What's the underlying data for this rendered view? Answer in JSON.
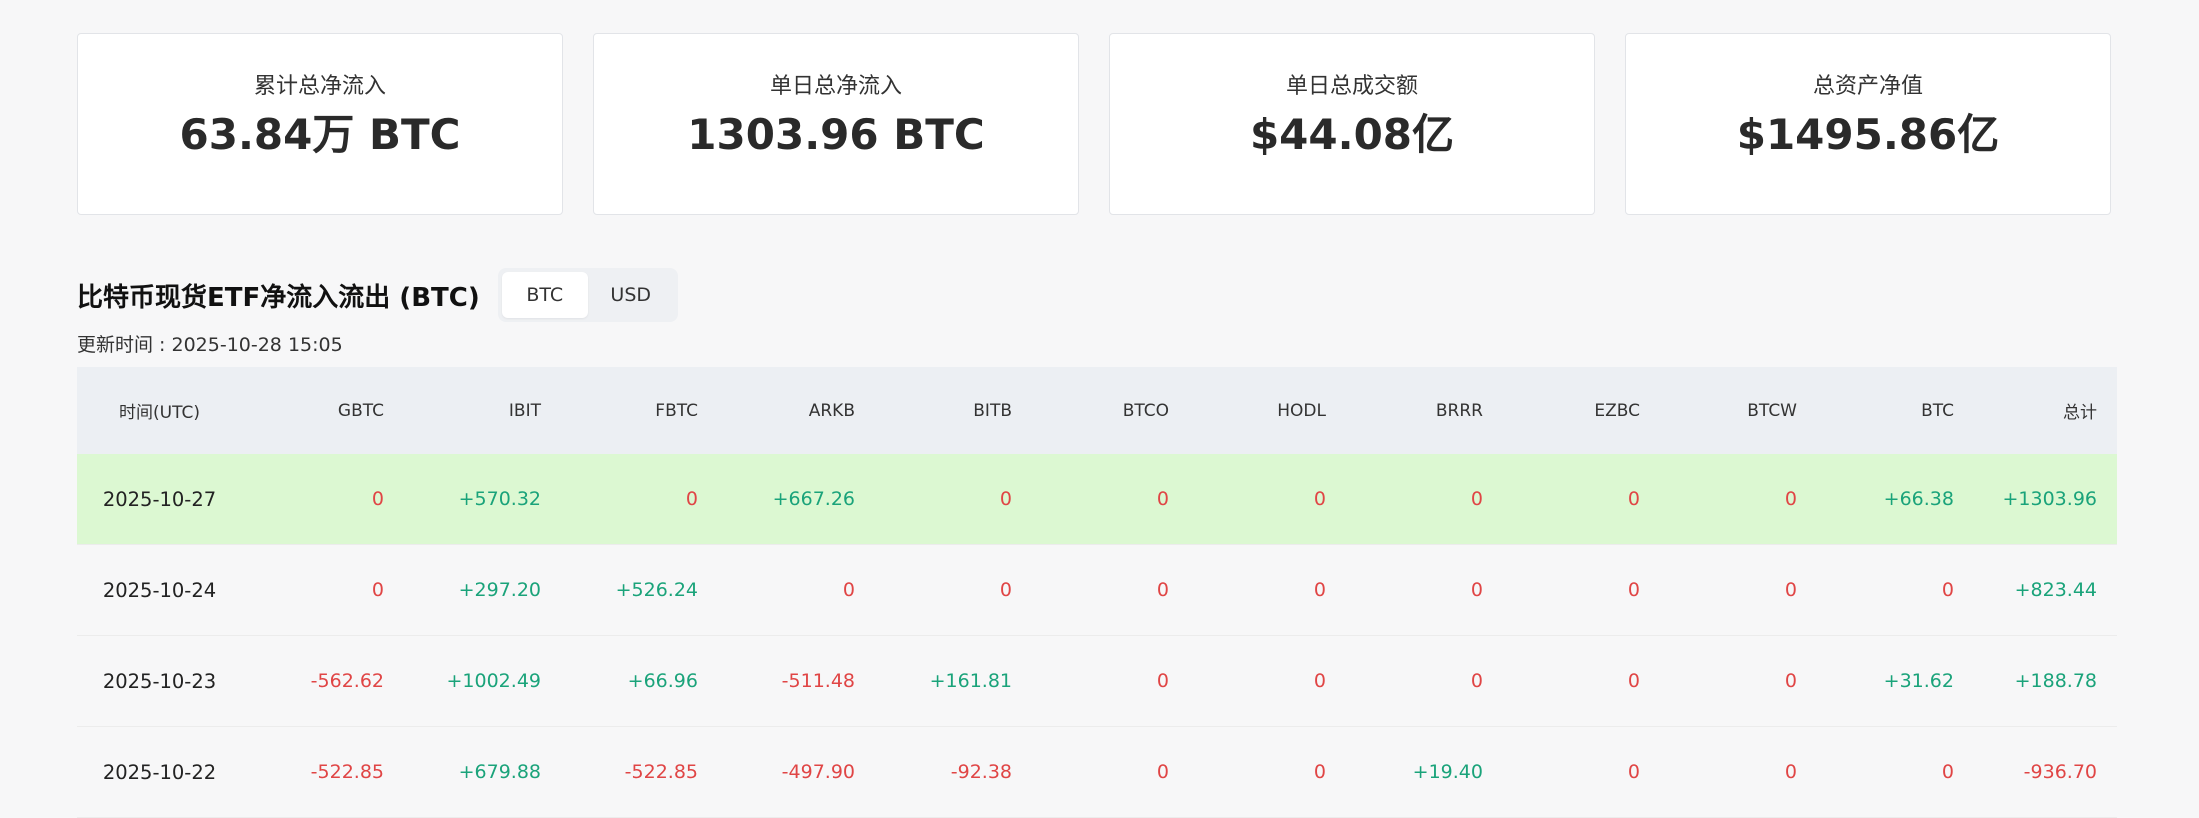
{
  "stats": [
    {
      "label": "累计总净流入",
      "value": "63.84万 BTC"
    },
    {
      "label": "单日总净流入",
      "value": "1303.96 BTC"
    },
    {
      "label": "单日总成交额",
      "value": "$44.08亿"
    },
    {
      "label": "总资产净值",
      "value": "$1495.86亿"
    }
  ],
  "section": {
    "title": "比特币现货ETF净流入流出 (BTC)",
    "toggle": {
      "options": [
        "BTC",
        "USD"
      ],
      "selected": "BTC"
    },
    "update_time": "更新时间 : 2025-10-28 15:05"
  },
  "colors": {
    "positive": "#1aa37a",
    "negative": "#e04545",
    "highlight_row": "#dcf8d2",
    "header_bg": "#eceff3"
  },
  "table": {
    "columns": [
      "时间(UTC)",
      "GBTC",
      "IBIT",
      "FBTC",
      "ARKB",
      "BITB",
      "BTCO",
      "HODL",
      "BRRR",
      "EZBC",
      "BTCW",
      "BTC",
      "总计"
    ],
    "rows": [
      {
        "date": "2025-10-27",
        "highlight": true,
        "values": [
          "0",
          "+570.32",
          "0",
          "+667.26",
          "0",
          "0",
          "0",
          "0",
          "0",
          "0",
          "+66.38",
          "+1303.96"
        ]
      },
      {
        "date": "2025-10-24",
        "highlight": false,
        "values": [
          "0",
          "+297.20",
          "+526.24",
          "0",
          "0",
          "0",
          "0",
          "0",
          "0",
          "0",
          "0",
          "+823.44"
        ]
      },
      {
        "date": "2025-10-23",
        "highlight": false,
        "values": [
          "-562.62",
          "+1002.49",
          "+66.96",
          "-511.48",
          "+161.81",
          "0",
          "0",
          "0",
          "0",
          "0",
          "+31.62",
          "+188.78"
        ]
      },
      {
        "date": "2025-10-22",
        "highlight": false,
        "values": [
          "-522.85",
          "+679.88",
          "-522.85",
          "-497.90",
          "-92.38",
          "0",
          "0",
          "+19.40",
          "0",
          "0",
          "0",
          "-936.70"
        ]
      }
    ]
  }
}
